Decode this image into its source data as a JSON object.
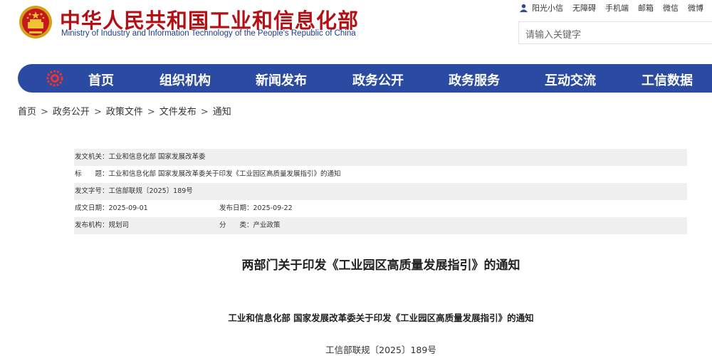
{
  "header": {
    "site_title": "中华人民共和国工业和信息化部",
    "site_subtitle": "Ministry of Industry and Information Technology of the People's Republic of China",
    "quick_links": [
      "阳光小信",
      "无障碍",
      "手机端",
      "邮箱",
      "微信",
      "微博"
    ],
    "search_placeholder": "请输入关键字"
  },
  "nav": {
    "items": [
      "首页",
      "组织机构",
      "新闻发布",
      "政务公开",
      "政务服务",
      "互动交流",
      "工信数据"
    ]
  },
  "breadcrumb": [
    "首页",
    "政务公开",
    "政策文件",
    "文件发布",
    "通知"
  ],
  "info": {
    "issuer": "发文机关：工业和信息化部 国家发展改革委",
    "title": "标　　题：工业和信息化部 国家发展改革委关于印发《工业园区高质量发展指引》的通知",
    "doc_no": "发文字号：工信部联规〔2025〕189号",
    "created": "成文日期：2025-09-01",
    "published": "发布日期：2025-09-22",
    "publisher": "发布机构：规划司",
    "category": "分　　类：产业政策"
  },
  "article": {
    "title": "两部门关于印发《工业园区高质量发展指引》的通知",
    "subtitle": "工业和信息化部 国家发展改革委关于印发《工业园区高质量发展指引》的通知",
    "doc_number": "工信部联规〔2025〕189号"
  },
  "colors": {
    "brand_red": "#b30f14",
    "nav_blue": "#2b4aa1"
  }
}
